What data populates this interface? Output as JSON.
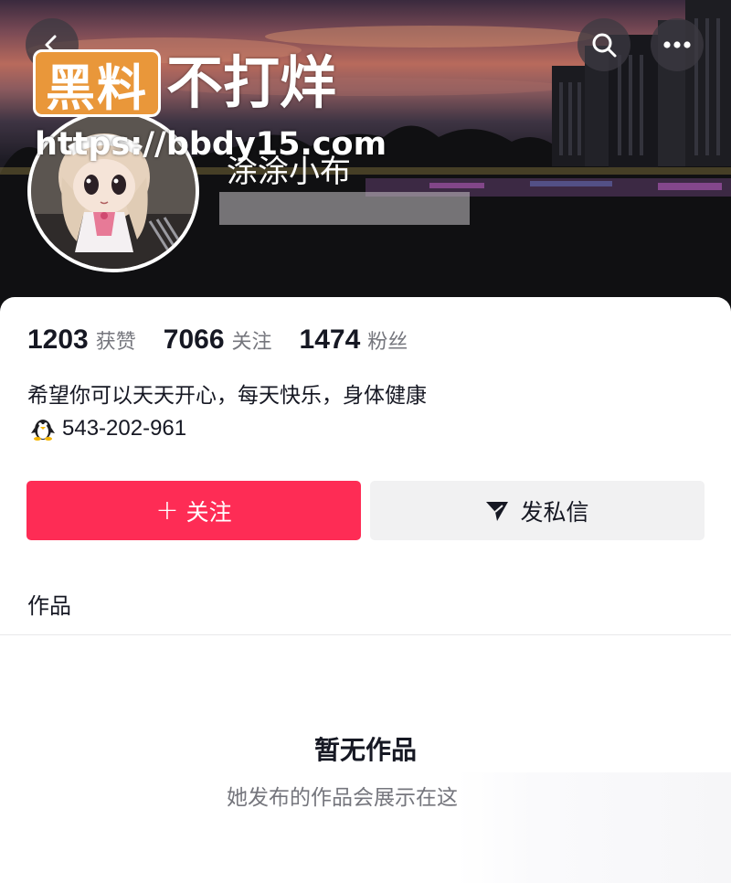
{
  "header": {
    "nav": {
      "back_icon": "chevron-left-icon",
      "search_icon": "search-icon",
      "more_icon": "more-dots-icon"
    },
    "watermark": {
      "badge_text": "黑料",
      "title": "不打烊",
      "url": "https://bbdy15.com"
    },
    "profile": {
      "nickname": "涂涂小布"
    }
  },
  "stats": [
    {
      "value": "1203",
      "label": "获赞"
    },
    {
      "value": "7066",
      "label": "关注"
    },
    {
      "value": "1474",
      "label": "粉丝"
    }
  ],
  "bio": {
    "text": "希望你可以天天开心，每天快乐，身体健康",
    "qq_number": "543-202-961",
    "qq_icon": "penguin-icon"
  },
  "actions": {
    "follow_label": "关注",
    "follow_icon": "plus-icon",
    "message_label": "发私信",
    "message_icon": "send-icon"
  },
  "tabs": {
    "works_label": "作品"
  },
  "empty_state": {
    "title": "暂无作品",
    "subtitle": "她发布的作品会展示在这"
  },
  "colors": {
    "accent": "#fe2c55",
    "secondary_button": "#f1f1f2",
    "muted_text": "#75767d",
    "watermark_orange": "#e9973a"
  }
}
